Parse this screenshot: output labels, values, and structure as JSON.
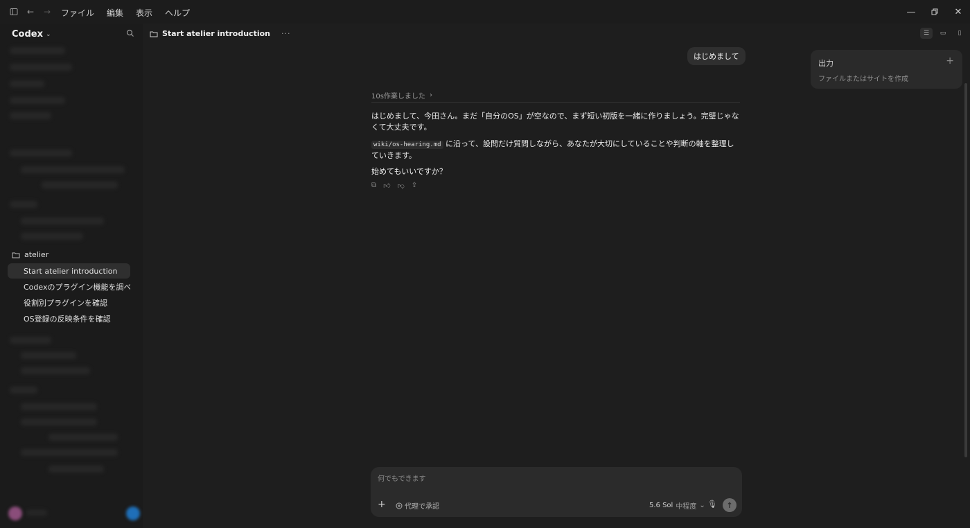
{
  "titlebar": {
    "menus": [
      "ファイル",
      "編集",
      "表示",
      "ヘルプ"
    ]
  },
  "sidebar": {
    "app_name": "Codex",
    "folder": "atelier",
    "threads": [
      "Start atelier introduction",
      "Codexのプラグイン機能を調べる",
      "役割別プラグインを確認",
      "OS登録の反映条件を確認"
    ]
  },
  "main": {
    "title": "Start atelier introduction",
    "user_message": "はじめまして",
    "worked": "10s作業しました",
    "reply": {
      "p1": "はじめまして、今田さん。まだ「自分のOS」が空なので、まず短い初版を一緒に作りましょう。完璧じゃなくて大丈夫です。",
      "code": "wiki/os-hearing.md",
      "p2_rest": " に沿って、設問だけ質問しながら、あなたが大切にしていることや判断の軸を整理していきます。",
      "p3": "始めてもいいですか？"
    }
  },
  "output_panel": {
    "title": "出力",
    "subtitle": "ファイルまたはサイトを作成"
  },
  "composer": {
    "placeholder": "何でもできます",
    "approve_label": "代理で承認",
    "model": "5.6 Sol",
    "effort": "中程度"
  }
}
